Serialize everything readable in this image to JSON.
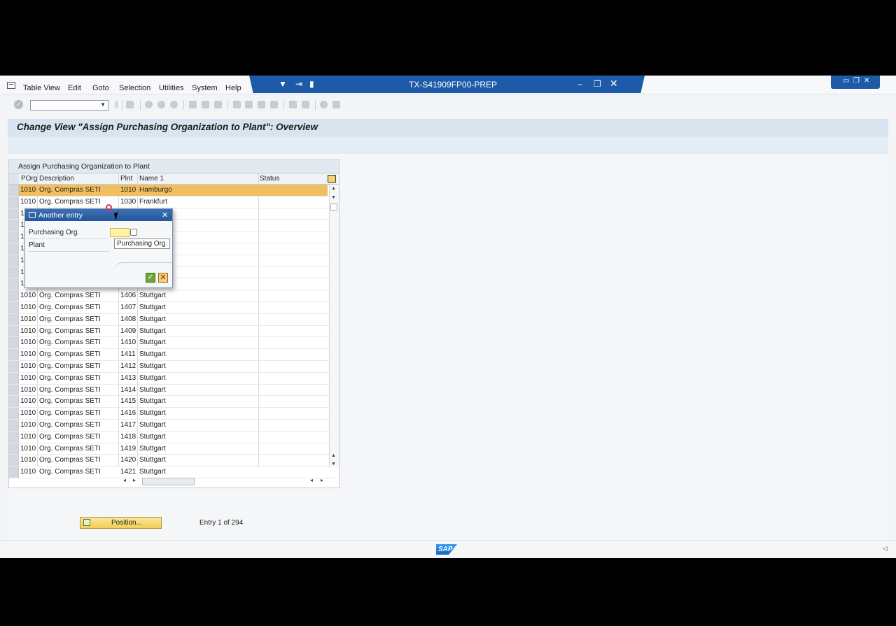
{
  "menu": [
    "Table View",
    "Edit",
    "Goto",
    "Selection",
    "Utilities",
    "System",
    "Help"
  ],
  "window_title": "TX-S41909FP00-PREP",
  "page_title": "Change View \"Assign Purchasing Organization to Plant\": Overview",
  "table": {
    "title": "Assign Purchasing Organization to Plant",
    "columns": [
      "POrg",
      "Description",
      "Plnt",
      "Name 1",
      "Status"
    ],
    "rows": [
      [
        "1010",
        "Org. Compras SETI",
        "1010",
        "Hamburgo",
        ""
      ],
      [
        "1010",
        "Org. Compras SETI",
        "1030",
        "Frankfurt",
        ""
      ],
      [
        "1",
        "",
        "",
        "",
        ""
      ],
      [
        "1",
        "",
        "",
        "",
        ""
      ],
      [
        "1",
        "",
        "",
        "",
        ""
      ],
      [
        "1",
        "",
        "",
        "",
        ""
      ],
      [
        "1",
        "",
        "",
        "",
        ""
      ],
      [
        "1",
        "",
        "",
        "",
        ""
      ],
      [
        "1",
        "",
        "",
        "",
        ""
      ],
      [
        "1010",
        "Org. Compras SETI",
        "1406",
        "Stuttgart",
        ""
      ],
      [
        "1010",
        "Org. Compras SETI",
        "1407",
        "Stuttgart",
        ""
      ],
      [
        "1010",
        "Org. Compras SETI",
        "1408",
        "Stuttgart",
        ""
      ],
      [
        "1010",
        "Org. Compras SETI",
        "1409",
        "Stuttgart",
        ""
      ],
      [
        "1010",
        "Org. Compras SETI",
        "1410",
        "Stuttgart",
        ""
      ],
      [
        "1010",
        "Org. Compras SETI",
        "1411",
        "Stuttgart",
        ""
      ],
      [
        "1010",
        "Org. Compras SETI",
        "1412",
        "Stuttgart",
        ""
      ],
      [
        "1010",
        "Org. Compras SETI",
        "1413",
        "Stuttgart",
        ""
      ],
      [
        "1010",
        "Org. Compras SETI",
        "1414",
        "Stuttgart",
        ""
      ],
      [
        "1010",
        "Org. Compras SETI",
        "1415",
        "Stuttgart",
        ""
      ],
      [
        "1010",
        "Org. Compras SETI",
        "1416",
        "Stuttgart",
        ""
      ],
      [
        "1010",
        "Org. Compras SETI",
        "1417",
        "Stuttgart",
        ""
      ],
      [
        "1010",
        "Org. Compras SETI",
        "1418",
        "Stuttgart",
        ""
      ],
      [
        "1010",
        "Org. Compras SETI",
        "1419",
        "Stuttgart",
        ""
      ],
      [
        "1010",
        "Org. Compras SETI",
        "1420",
        "Stuttgart",
        ""
      ],
      [
        "1010",
        "Org. Compras SETI",
        "1421",
        "Stuttgart",
        ""
      ]
    ],
    "highlighted_row": 0
  },
  "position_button": "Position...",
  "entry_info": "Entry 1 of 294",
  "dialog": {
    "title": "Another entry",
    "field1_label": "Purchasing Org.",
    "field2_label": "Plant",
    "tooltip": "Purchasing Org."
  },
  "logo": "SAP",
  "colors": {
    "title_bar": "#1d5aa7",
    "highlight_row": "#f0c060",
    "input_focus": "#fff3a5"
  }
}
